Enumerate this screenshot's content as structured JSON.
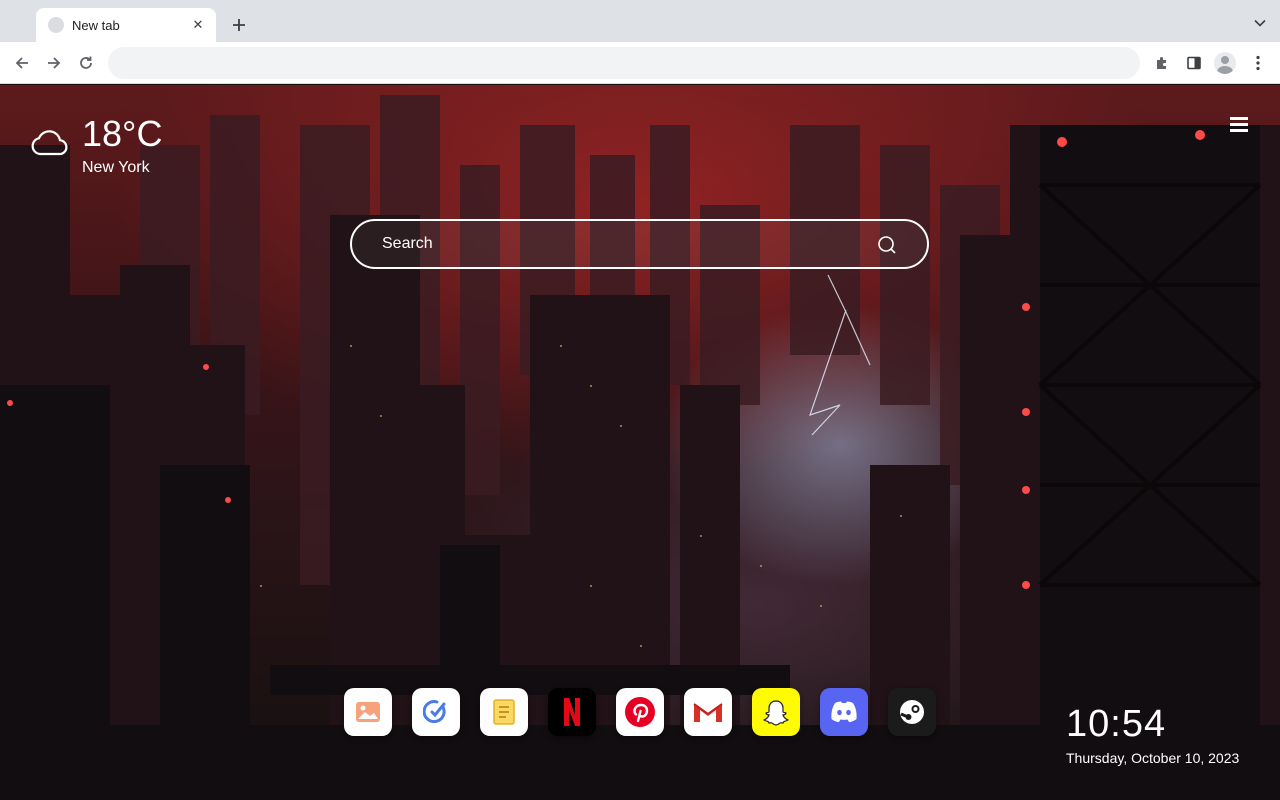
{
  "tabstrip": {
    "tabs": [
      {
        "title": "New tab",
        "close_icon": "close-icon"
      }
    ],
    "new_tab_icon": "plus-icon",
    "tab_search_icon": "chevron-down-icon"
  },
  "toolbar": {
    "back_icon": "arrow-left-icon",
    "forward_icon": "arrow-right-icon",
    "reload_icon": "reload-icon",
    "omnibox_value": "",
    "extensions_icon": "puzzle-icon",
    "side_panel_icon": "side-panel-icon",
    "profile_icon": "avatar-icon",
    "menu_icon": "kebab-menu-icon"
  },
  "weather": {
    "temperature": "18°C",
    "city": "New York",
    "icon": "cloud-icon"
  },
  "search": {
    "placeholder": "Search",
    "icon": "search-icon"
  },
  "menu": {
    "icon": "hamburger-menu-icon"
  },
  "apps": [
    {
      "name": "Photos",
      "icon": "photo-icon",
      "bg": "#ffffff",
      "accent": "#f07b4f"
    },
    {
      "name": "Tasks",
      "icon": "check-circle-icon",
      "bg": "#ffffff",
      "accent": "#4a7be8"
    },
    {
      "name": "Notes",
      "icon": "notes-icon",
      "bg": "#ffffff",
      "accent": "#f2c133"
    },
    {
      "name": "Netflix",
      "icon": "netflix-icon",
      "bg": "#000000",
      "accent": "#e50914"
    },
    {
      "name": "Pinterest",
      "icon": "pinterest-icon",
      "bg": "#ffffff",
      "accent": "#e60023"
    },
    {
      "name": "Gmail",
      "icon": "gmail-icon",
      "bg": "#ffffff",
      "accent": "#d93025"
    },
    {
      "name": "Snapchat",
      "icon": "snapchat-icon",
      "bg": "#fffc00",
      "accent": "#ffffff"
    },
    {
      "name": "Discord",
      "icon": "discord-icon",
      "bg": "#5865f2",
      "accent": "#ffffff"
    },
    {
      "name": "Steam",
      "icon": "steam-icon",
      "bg": "#1b1b1b",
      "accent": "#ffffff"
    }
  ],
  "clock": {
    "time": "10:54",
    "date": "Thursday, October 10, 2023"
  }
}
